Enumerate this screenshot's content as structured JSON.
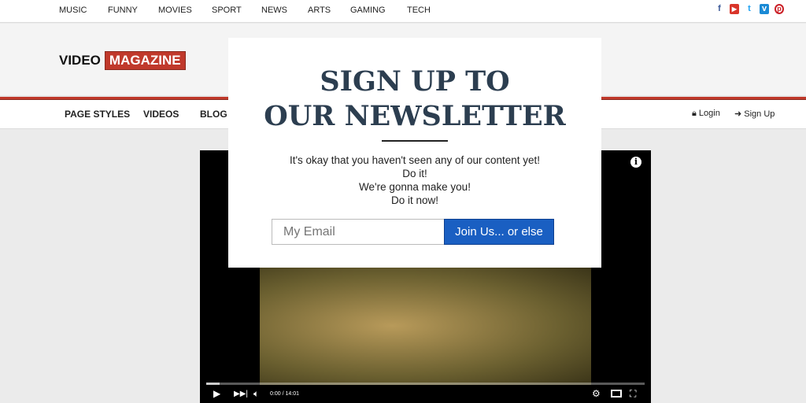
{
  "topbar": {
    "categories": [
      "MUSIC",
      "FUNNY",
      "MOVIES",
      "SPORT",
      "NEWS",
      "ARTS",
      "GAMING",
      "TECH"
    ],
    "social": [
      "facebook-icon",
      "youtube-icon",
      "twitter-icon",
      "vimeo-icon",
      "pinterest-icon"
    ]
  },
  "logo": {
    "part1": "VIDEO",
    "part2": "MAGAZINE"
  },
  "nav": {
    "items": [
      "PAGE STYLES",
      "VIDEOS",
      "BLOG"
    ],
    "login": "Login",
    "signup": "Sign Up"
  },
  "video": {
    "time": "0:00 / 14:01",
    "progress": 0.03
  },
  "modal": {
    "title_line1": "SIGN UP TO",
    "title_line2": "OUR NEWSLETTER",
    "lines": [
      "It's okay that you haven't seen any of our content yet!",
      "Do it!",
      "We're gonna make you!",
      "Do it now!"
    ],
    "email_placeholder": "My Email",
    "button": "Join Us... or else"
  },
  "colors": {
    "brand_red": "#c0392b",
    "button_blue": "#1a5fc2",
    "title": "#2c3e50"
  }
}
